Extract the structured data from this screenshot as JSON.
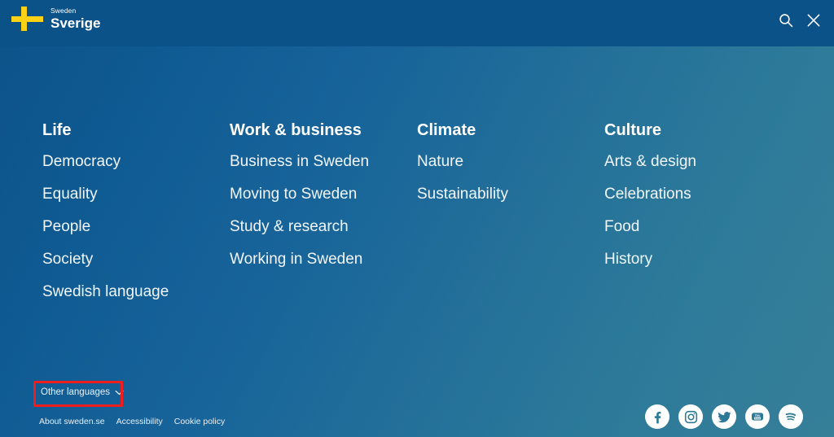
{
  "header": {
    "brand": {
      "small_text": "Sweden",
      "large_text": "Sverige",
      "flag_color": "#fdd216",
      "icon": "swedish-flag-cross"
    },
    "actions": [
      {
        "name": "search-icon",
        "label": "Search"
      },
      {
        "name": "close-icon",
        "label": "Close"
      }
    ]
  },
  "nav": {
    "columns": [
      {
        "title": "Life",
        "links": [
          "Democracy",
          "Equality",
          "People",
          "Society",
          "Swedish language"
        ]
      },
      {
        "title": "Work & business",
        "links": [
          "Business in Sweden",
          "Moving to Sweden",
          "Study & research",
          "Working in Sweden"
        ]
      },
      {
        "title": "Climate",
        "links": [
          "Nature",
          "Sustainability"
        ]
      },
      {
        "title": "Culture",
        "links": [
          "Arts & design",
          "Celebrations",
          "Food",
          "History"
        ]
      }
    ]
  },
  "languages": {
    "label": "Other languages",
    "chevron": "chevron-down-icon",
    "highlight_color": "#ef1d1d",
    "highlighted": true
  },
  "footer": {
    "links": [
      "About sweden.se",
      "Accessibility",
      "Cookie policy"
    ],
    "socials": [
      {
        "name": "facebook-icon",
        "label": "Facebook"
      },
      {
        "name": "instagram-icon",
        "label": "Instagram"
      },
      {
        "name": "twitter-icon",
        "label": "Twitter"
      },
      {
        "name": "youtube-icon",
        "label": "YouTube"
      },
      {
        "name": "spotify-icon",
        "label": "Spotify"
      }
    ]
  },
  "theme": {
    "gradient_start": "#0b5289",
    "gradient_end": "#367f99",
    "text_color": "#ffffff"
  }
}
